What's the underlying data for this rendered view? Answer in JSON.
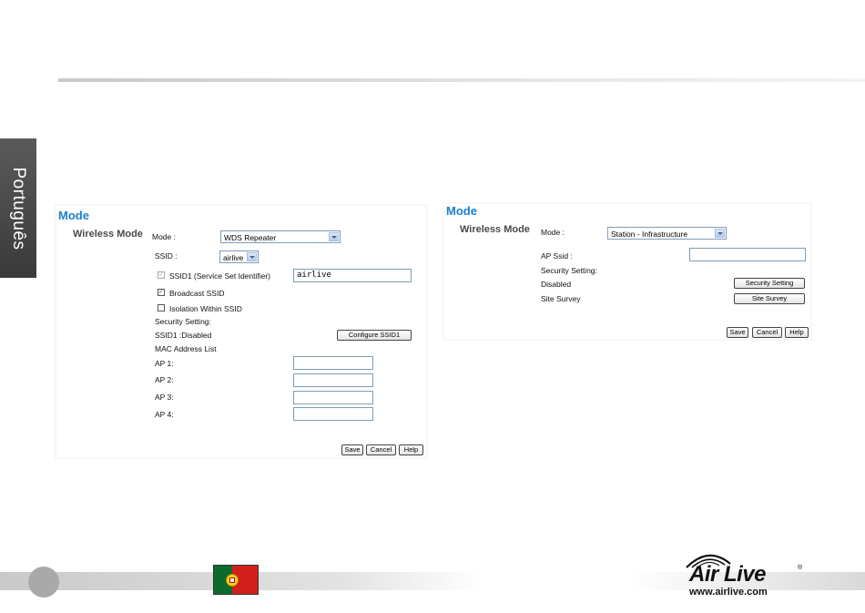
{
  "sidebar": {
    "language": "Português"
  },
  "left_panel": {
    "title": "Mode",
    "section": "Wireless Mode",
    "mode_label": "Mode :",
    "mode_value": "WDS Repeater",
    "ssid_label": "SSID :",
    "ssid_value": "airlive",
    "ssid1_label": "SSID1 (Service Set Identifier)",
    "ssid1_value": "airlive",
    "broadcast_label": "Broadcast SSID",
    "isolation_label": "Isolation Within SSID",
    "security_label": "Security Setting:",
    "ssid1_status": "SSID1 :Disabled",
    "configure_button": "Configure SSID1",
    "mac_list_label": "MAC Address List",
    "ap_fields": [
      {
        "label": "AP 1:",
        "value": ""
      },
      {
        "label": "AP 2:",
        "value": ""
      },
      {
        "label": "AP 3:",
        "value": ""
      },
      {
        "label": "AP 4:",
        "value": ""
      }
    ],
    "save_button": "Save",
    "cancel_button": "Cancel",
    "help_button": "Help"
  },
  "right_panel": {
    "title": "Mode",
    "section": "Wireless Mode",
    "mode_label": "Mode :",
    "mode_value": "Station - Infrastructure",
    "ap_ssid_label": "AP Ssid :",
    "ap_ssid_value": "",
    "security_label": "Security Setting:",
    "security_status": "Disabled",
    "security_button": "Security Setting",
    "site_survey_label": "Site Survey",
    "site_survey_button": "Site Survey",
    "save_button": "Save",
    "cancel_button": "Cancel",
    "help_button": "Help"
  },
  "footer": {
    "logo_text": "Air Live",
    "url": "www.airlive.com"
  },
  "colors": {
    "title_blue": "#1a7fd0",
    "sidebar_dark": "#4a4a4a",
    "flag_green": "#0a6b2c",
    "flag_red": "#d21f1b"
  }
}
